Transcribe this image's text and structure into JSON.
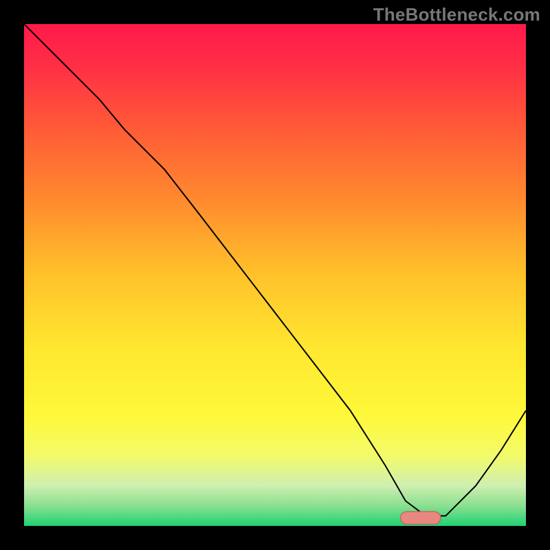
{
  "watermark": "TheBottleneck.com",
  "colors": {
    "frame": "#000000",
    "curve": "#000000",
    "marker_fill": "#e8887e",
    "marker_stroke": "#c06a60",
    "gradient_stops": [
      {
        "offset": 0.0,
        "color": "#ff1a4a"
      },
      {
        "offset": 0.08,
        "color": "#ff2d46"
      },
      {
        "offset": 0.2,
        "color": "#ff5838"
      },
      {
        "offset": 0.35,
        "color": "#ff8a2e"
      },
      {
        "offset": 0.5,
        "color": "#ffc22a"
      },
      {
        "offset": 0.65,
        "color": "#ffe830"
      },
      {
        "offset": 0.78,
        "color": "#fff83a"
      },
      {
        "offset": 0.86,
        "color": "#f3fb6a"
      },
      {
        "offset": 0.92,
        "color": "#ceefb0"
      },
      {
        "offset": 0.96,
        "color": "#8adf90"
      },
      {
        "offset": 1.0,
        "color": "#1fd274"
      }
    ]
  },
  "chart_data": {
    "type": "line",
    "title": "",
    "xlabel": "",
    "ylabel": "",
    "xlim": [
      0,
      100
    ],
    "ylim": [
      0,
      100
    ],
    "grid": false,
    "legend": false,
    "series": [
      {
        "name": "bottleneck-curve",
        "x": [
          0,
          5,
          10,
          15,
          20,
          25,
          28,
          35,
          45,
          55,
          65,
          72,
          76,
          80,
          84,
          90,
          95,
          100
        ],
        "y": [
          100,
          95,
          90,
          85,
          79,
          74,
          71,
          62,
          49,
          36,
          23,
          12,
          5,
          2,
          2,
          8,
          15,
          23
        ]
      }
    ],
    "marker": {
      "name": "optimal-range",
      "x": 79,
      "y": 1.6,
      "width": 8,
      "height": 2.5
    }
  }
}
